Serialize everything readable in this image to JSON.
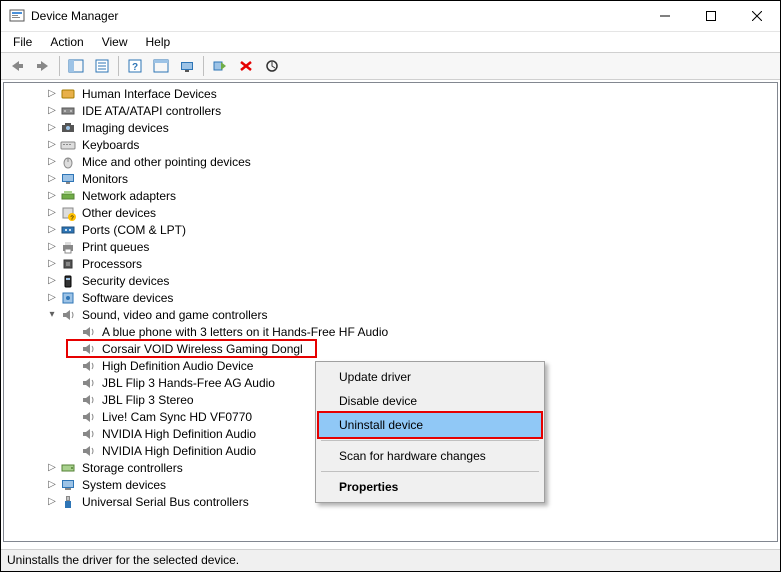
{
  "window": {
    "title": "Device Manager"
  },
  "menu": {
    "file": "File",
    "action": "Action",
    "view": "View",
    "help": "Help"
  },
  "tree": {
    "items": [
      {
        "label": "Human Interface Devices",
        "depth": 2,
        "expander": "▷",
        "icon": "hid"
      },
      {
        "label": "IDE ATA/ATAPI controllers",
        "depth": 2,
        "expander": "▷",
        "icon": "ide"
      },
      {
        "label": "Imaging devices",
        "depth": 2,
        "expander": "▷",
        "icon": "imaging"
      },
      {
        "label": "Keyboards",
        "depth": 2,
        "expander": "▷",
        "icon": "keyboard"
      },
      {
        "label": "Mice and other pointing devices",
        "depth": 2,
        "expander": "▷",
        "icon": "mouse"
      },
      {
        "label": "Monitors",
        "depth": 2,
        "expander": "▷",
        "icon": "monitor"
      },
      {
        "label": "Network adapters",
        "depth": 2,
        "expander": "▷",
        "icon": "network"
      },
      {
        "label": "Other devices",
        "depth": 2,
        "expander": "▷",
        "icon": "other"
      },
      {
        "label": "Ports (COM & LPT)",
        "depth": 2,
        "expander": "▷",
        "icon": "port"
      },
      {
        "label": "Print queues",
        "depth": 2,
        "expander": "▷",
        "icon": "printer"
      },
      {
        "label": "Processors",
        "depth": 2,
        "expander": "▷",
        "icon": "cpu"
      },
      {
        "label": "Security devices",
        "depth": 2,
        "expander": "▷",
        "icon": "security"
      },
      {
        "label": "Software devices",
        "depth": 2,
        "expander": "▷",
        "icon": "software"
      },
      {
        "label": "Sound, video and game controllers",
        "depth": 2,
        "expander": "▾",
        "icon": "sound"
      },
      {
        "label": "A blue phone with 3 letters on it Hands-Free HF Audio",
        "depth": 3,
        "expander": "",
        "icon": "speaker"
      },
      {
        "label": "Corsair VOID Wireless Gaming Dongl",
        "depth": 3,
        "expander": "",
        "icon": "speaker",
        "highlight": true
      },
      {
        "label": "High Definition Audio Device",
        "depth": 3,
        "expander": "",
        "icon": "speaker"
      },
      {
        "label": "JBL Flip 3 Hands-Free AG Audio",
        "depth": 3,
        "expander": "",
        "icon": "speaker"
      },
      {
        "label": "JBL Flip 3 Stereo",
        "depth": 3,
        "expander": "",
        "icon": "speaker"
      },
      {
        "label": "Live! Cam Sync HD VF0770",
        "depth": 3,
        "expander": "",
        "icon": "speaker"
      },
      {
        "label": "NVIDIA High Definition Audio",
        "depth": 3,
        "expander": "",
        "icon": "speaker"
      },
      {
        "label": "NVIDIA High Definition Audio",
        "depth": 3,
        "expander": "",
        "icon": "speaker"
      },
      {
        "label": "Storage controllers",
        "depth": 2,
        "expander": "▷",
        "icon": "storage"
      },
      {
        "label": "System devices",
        "depth": 2,
        "expander": "▷",
        "icon": "system"
      },
      {
        "label": "Universal Serial Bus controllers",
        "depth": 2,
        "expander": "▷",
        "icon": "usb"
      }
    ]
  },
  "context_menu": {
    "update": "Update driver",
    "disable": "Disable device",
    "uninstall": "Uninstall device",
    "scan": "Scan for hardware changes",
    "properties": "Properties"
  },
  "statusbar": {
    "text": "Uninstalls the driver for the selected device."
  }
}
